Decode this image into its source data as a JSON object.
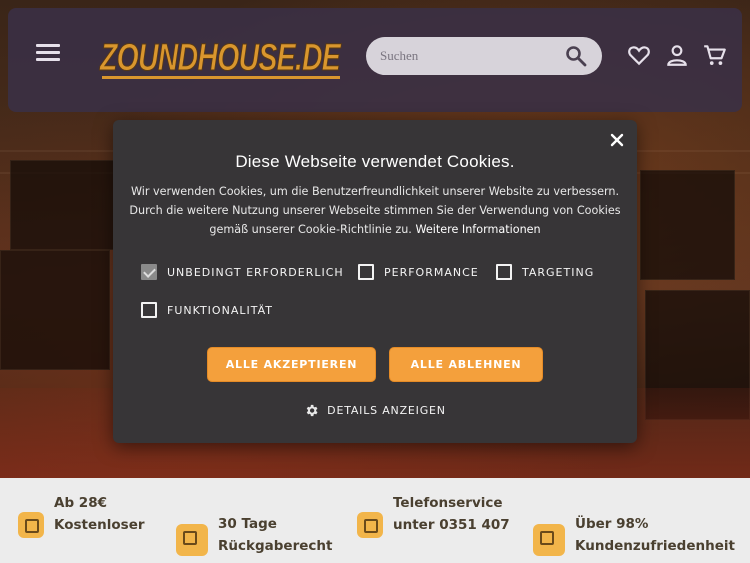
{
  "header": {
    "logo_text": "ZOUNDHOUSE.DE",
    "search_placeholder": "Suchen",
    "icons": [
      "menu-icon",
      "search-icon",
      "heart-icon",
      "user-icon",
      "cart-icon"
    ]
  },
  "cookie_dialog": {
    "title": "Diese Webseite verwendet Cookies.",
    "description": "Wir verwenden Cookies, um die Benutzerfreundlichkeit unserer Website zu verbessern. Durch die weitere Nutzung unserer Webseite stimmen Sie der Verwendung von Cookies gemäß unserer Cookie-Richtlinie zu.",
    "more_info_link": "Weitere Informationen",
    "options": [
      {
        "label": "UNBEDINGT ERFORDERLICH",
        "checked": true
      },
      {
        "label": "PERFORMANCE",
        "checked": false
      },
      {
        "label": "TARGETING",
        "checked": false
      },
      {
        "label": "FUNKTIONALITÄT",
        "checked": false
      }
    ],
    "accept_all": "ALLE AKZEPTIEREN",
    "reject_all": "ALLE ABLEHNEN",
    "details": "DETAILS ANZEIGEN"
  },
  "features": [
    {
      "lines": [
        "Ab 28€",
        "Kostenloser"
      ]
    },
    {
      "lines": [
        "30 Tage",
        "Rückgaberecht"
      ]
    },
    {
      "lines": [
        "Telefonservice",
        "unter 0351 407"
      ]
    },
    {
      "lines": [
        "Über 98%",
        "Kundenzufriedenheit"
      ]
    }
  ],
  "colors": {
    "accent": "#f4a03c",
    "header_bg": "#3a3046",
    "dialog_bg": "#373537",
    "logo": "#d9962e"
  }
}
